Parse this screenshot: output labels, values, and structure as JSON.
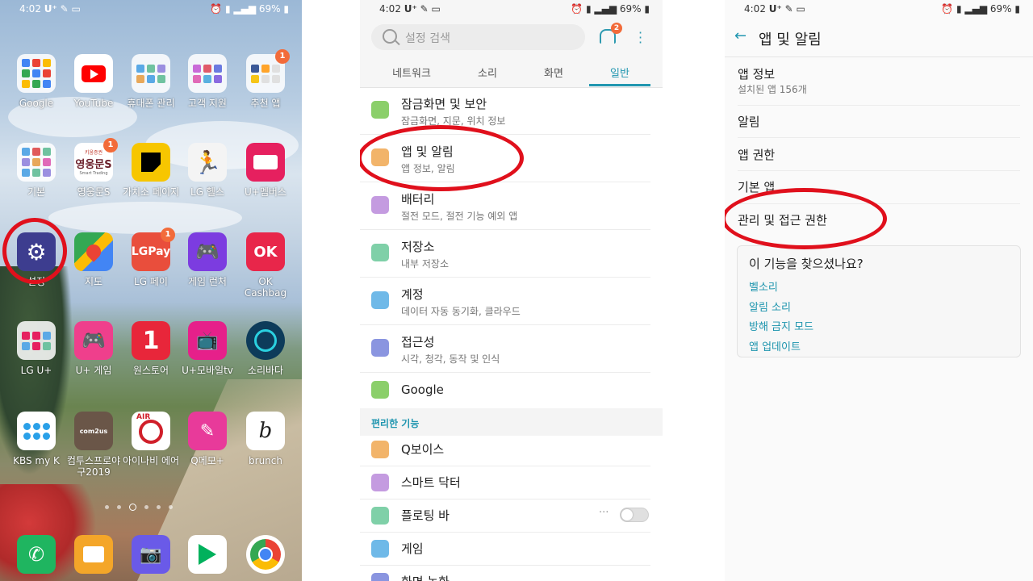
{
  "status_bar": {
    "time": "4:02",
    "network": "U⁺",
    "battery": "69%"
  },
  "home": {
    "apps": [
      {
        "label": "Google",
        "icon": "google-folder-icon"
      },
      {
        "label": "YouTube",
        "icon": "youtube-icon"
      },
      {
        "label": "휴대폰 관리",
        "icon": "phone-manager-folder-icon"
      },
      {
        "label": "고객 지원",
        "icon": "customer-support-folder-icon"
      },
      {
        "label": "추천 앱",
        "icon": "recommended-apps-folder-icon",
        "badge": "1"
      },
      {
        "label": "기본",
        "icon": "basic-folder-icon"
      },
      {
        "label": "영웅문S",
        "icon": "heroes-trading-icon",
        "badge": "1",
        "icon_text": "영웅문S",
        "icon_top_text": "키움증권",
        "icon_sub_text": "Smart Trading"
      },
      {
        "label": "가치소 페이지",
        "icon": "sticky-note-icon"
      },
      {
        "label": "LG 헬스",
        "icon": "lg-health-icon"
      },
      {
        "label": "U+멤버스",
        "icon": "uplus-members-icon"
      },
      {
        "label": "설정",
        "icon": "settings-gear-icon"
      },
      {
        "label": "지도",
        "icon": "maps-icon"
      },
      {
        "label": "LG 페이",
        "icon": "lg-pay-icon",
        "badge": "1",
        "icon_text": "LGPay"
      },
      {
        "label": "게임 런처",
        "icon": "game-launcher-icon"
      },
      {
        "label": "OK Cashbag",
        "icon": "ok-cashbag-icon",
        "icon_text": "OK"
      },
      {
        "label": "LG U+",
        "icon": "lg-uplus-folder-icon"
      },
      {
        "label": "U+ 게임",
        "icon": "uplus-game-icon"
      },
      {
        "label": "원스토어",
        "icon": "onestore-icon",
        "icon_text": "1"
      },
      {
        "label": "U+모바일tv",
        "icon": "uplus-tv-icon"
      },
      {
        "label": "소리바다",
        "icon": "soribada-icon"
      },
      {
        "label": "KBS my K",
        "icon": "kbs-mykey-icon"
      },
      {
        "label": "컴투스프로야구2019",
        "icon": "com2us-baseball-icon",
        "icon_text": "com2us"
      },
      {
        "label": "아이나비 에어",
        "icon": "inavi-air-icon",
        "icon_text": "AIR"
      },
      {
        "label": "Q메모+",
        "icon": "qmemo-icon"
      },
      {
        "label": "brunch",
        "icon": "brunch-icon",
        "icon_text": "b"
      }
    ],
    "dock": [
      {
        "name": "phone-icon"
      },
      {
        "name": "messages-icon"
      },
      {
        "name": "camera-icon"
      },
      {
        "name": "play-store-icon"
      },
      {
        "name": "chrome-icon"
      }
    ]
  },
  "settings": {
    "search_placeholder": "설정 검색",
    "notification_count": "2",
    "tabs": [
      {
        "label": "네트워크",
        "active": false
      },
      {
        "label": "소리",
        "active": false
      },
      {
        "label": "화면",
        "active": false
      },
      {
        "label": "일반",
        "active": true
      }
    ],
    "items": [
      {
        "title": "잠금화면 및 보안",
        "subtitle": "잠금화면, 지문, 위치 정보",
        "icon": "lock-icon",
        "color": "#8bcf6a"
      },
      {
        "title": "앱 및 알림",
        "subtitle": "앱 정보, 알림",
        "icon": "apps-grid-icon",
        "color": "#f2b46a"
      },
      {
        "title": "배터리",
        "subtitle": "절전 모드, 절전 기능 예외 앱",
        "icon": "battery-icon",
        "color": "#c49be0"
      },
      {
        "title": "저장소",
        "subtitle": "내부 저장소",
        "icon": "storage-icon",
        "color": "#7fd0a8"
      },
      {
        "title": "계정",
        "subtitle": "데이터 자동 동기화, 클라우드",
        "icon": "account-icon",
        "color": "#6fb9e8"
      },
      {
        "title": "접근성",
        "subtitle": "시각, 청각, 동작 및 인식",
        "icon": "accessibility-icon",
        "color": "#8a95e0"
      },
      {
        "title": "Google",
        "subtitle": "",
        "icon": "google-g-icon",
        "color": "#8bcf6a"
      }
    ],
    "section_label": "편리한 기능",
    "extra_items": [
      {
        "title": "Q보이스",
        "icon": "qvoice-icon",
        "color": "#f2b46a"
      },
      {
        "title": "스마트 닥터",
        "icon": "smart-doctor-icon",
        "color": "#c49be0"
      },
      {
        "title": "플로팅 바",
        "icon": "floating-bar-icon",
        "color": "#7fd0a8",
        "more": "···",
        "toggle_on": false
      },
      {
        "title": "게임",
        "icon": "game-icon",
        "color": "#6fb9e8"
      },
      {
        "title": "화면 녹화",
        "icon": "screen-record-icon",
        "color": "#8a95e0"
      }
    ]
  },
  "app_notifications": {
    "title": "앱 및 알림",
    "items": [
      {
        "title": "앱 정보",
        "subtitle": "설치된 앱 156개"
      },
      {
        "title": "알림",
        "subtitle": ""
      },
      {
        "title": "앱 권한",
        "subtitle": ""
      },
      {
        "title": "기본 앱",
        "subtitle": ""
      },
      {
        "title": "관리 및 접근 권한",
        "subtitle": ""
      }
    ],
    "card_title": "이 기능을 찾으셨나요?",
    "card_links": [
      "벨소리",
      "알림 소리",
      "방해 금지 모드",
      "앱 업데이트"
    ]
  },
  "colors": {
    "accent": "#2196b0",
    "highlight": "#e0101c"
  }
}
